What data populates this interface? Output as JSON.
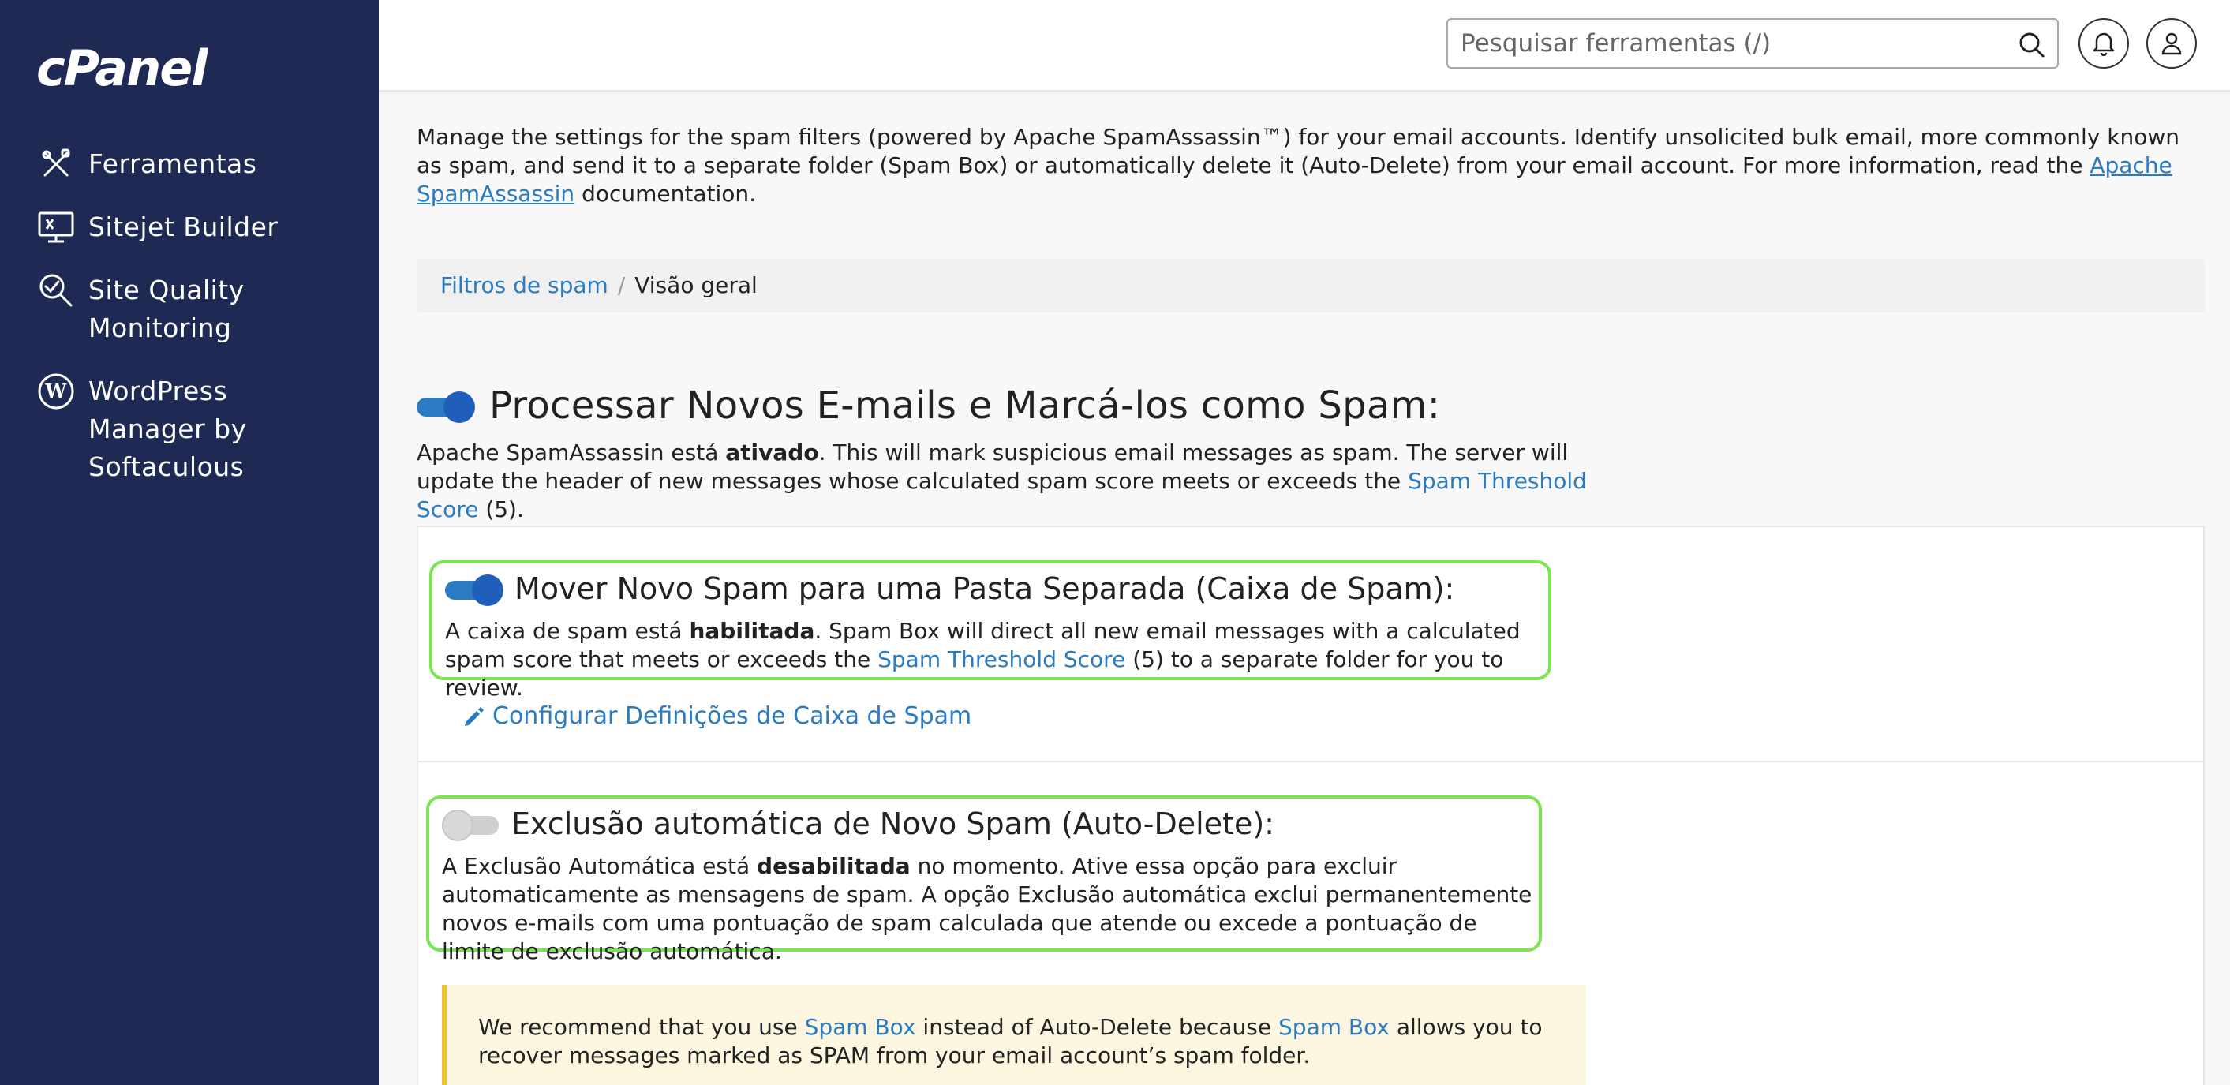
{
  "sidebar": {
    "logo": "cPanel",
    "items": [
      {
        "label": "Ferramentas",
        "icon": "tools-icon"
      },
      {
        "label": "Sitejet Builder",
        "icon": "monitor-icon"
      },
      {
        "label": "Site Quality Monitoring",
        "icon": "magnifier-check-icon"
      },
      {
        "label": "WordPress Manager by Softaculous",
        "icon": "wordpress-icon"
      }
    ]
  },
  "header": {
    "search_placeholder": "Pesquisar ferramentas (/)"
  },
  "intro": {
    "text_before": "Manage the settings for the spam filters (powered by Apache SpamAssassin™) for your email accounts. Identify unsolicited bulk email, more commonly known as spam, and send it to a separate folder (Spam Box) or automatically delete it (Auto-Delete) from your email account. For more information, read the ",
    "link": "Apache SpamAssassin",
    "text_after": " documentation."
  },
  "breadcrumb": {
    "parent": "Filtros de spam",
    "separator": "/",
    "current": "Visão geral"
  },
  "process": {
    "enabled": true,
    "title": "Processar Novos E-mails e Marcá-los como Spam:",
    "text_before": "Apache SpamAssassin está ",
    "status": "ativado",
    "text_middle": ". This will mark suspicious email messages as spam. The server will update the header of new messages whose calculated spam score meets or exceeds the ",
    "link": "Spam Threshold Score",
    "text_after": " (5)."
  },
  "spam_box": {
    "enabled": true,
    "title": "Mover Novo Spam para uma Pasta Separada (Caixa de Spam):",
    "text_before": "A caixa de spam está ",
    "status": "habilitada",
    "text_middle": ". Spam Box will direct all new email messages with a calculated spam score that meets or exceeds the ",
    "link": "Spam Threshold Score",
    "text_after": " (5) to a separate folder for you to review.",
    "configure_label": "Configurar Definições de Caixa de Spam"
  },
  "auto_delete": {
    "enabled": false,
    "title": "Exclusão automática de Novo Spam (Auto-Delete):",
    "text_before": "A Exclusão Automática está ",
    "status": "desabilitada",
    "text_after": " no momento. Ative essa opção para excluir automaticamente as mensagens de spam. A opção Exclusão automática exclui permanentemente novos e-mails com uma pontuação de spam calculada que atende ou excede a pontuação de limite de exclusão automática."
  },
  "warning": {
    "text_1": "We recommend that you use ",
    "link_1": "Spam Box",
    "text_2": " instead of Auto-Delete because ",
    "link_2": "Spam Box",
    "text_3": " allows you to recover messages marked as SPAM from your email account’s spam folder."
  },
  "colors": {
    "sidebar_bg": "#1f2a54",
    "link": "#2a7bc1",
    "highlight": "#7be354",
    "warning_bg": "#fcf5df",
    "warning_border": "#f1c232"
  }
}
